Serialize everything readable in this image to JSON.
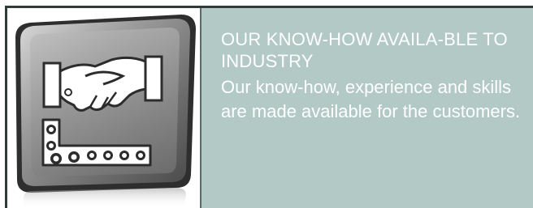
{
  "banner": {
    "headline": "OUR KNOW-HOW AVAILA-BLE TO INDUSTRY",
    "body": "Our know-how, experience and skills are made available for the customers."
  },
  "icon": {
    "name": "handshake-and-chain-icon"
  },
  "colors": {
    "panel_background": "#b2c9c5",
    "text": "#ffffff",
    "frame": "#2f3a39",
    "icon_tile_dark": "#3c3c3c",
    "icon_tile_light": "#a9a9a9"
  }
}
